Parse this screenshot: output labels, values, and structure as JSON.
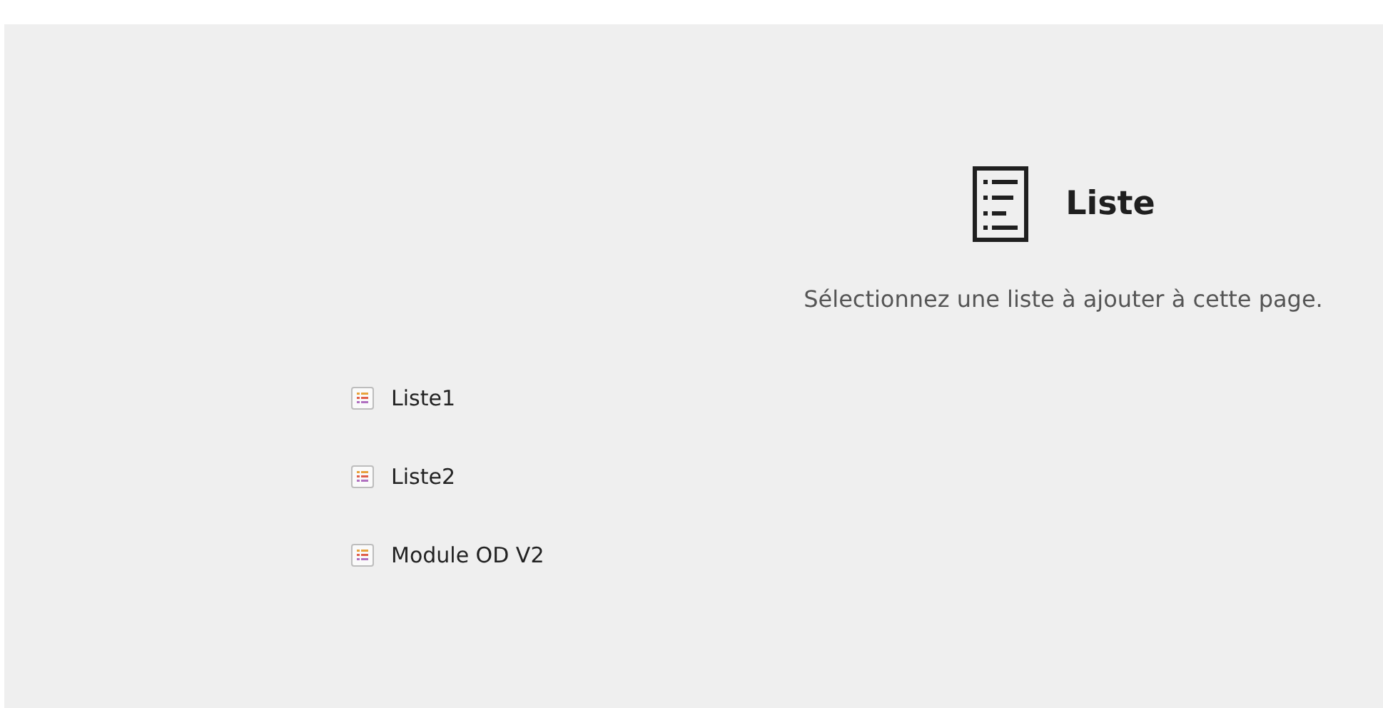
{
  "header": {
    "title": "Liste",
    "description": "Sélectionnez une liste à ajouter à cette page."
  },
  "lists": [
    {
      "label": "Liste1"
    },
    {
      "label": "Liste2"
    },
    {
      "label": "Module OD V2"
    }
  ]
}
